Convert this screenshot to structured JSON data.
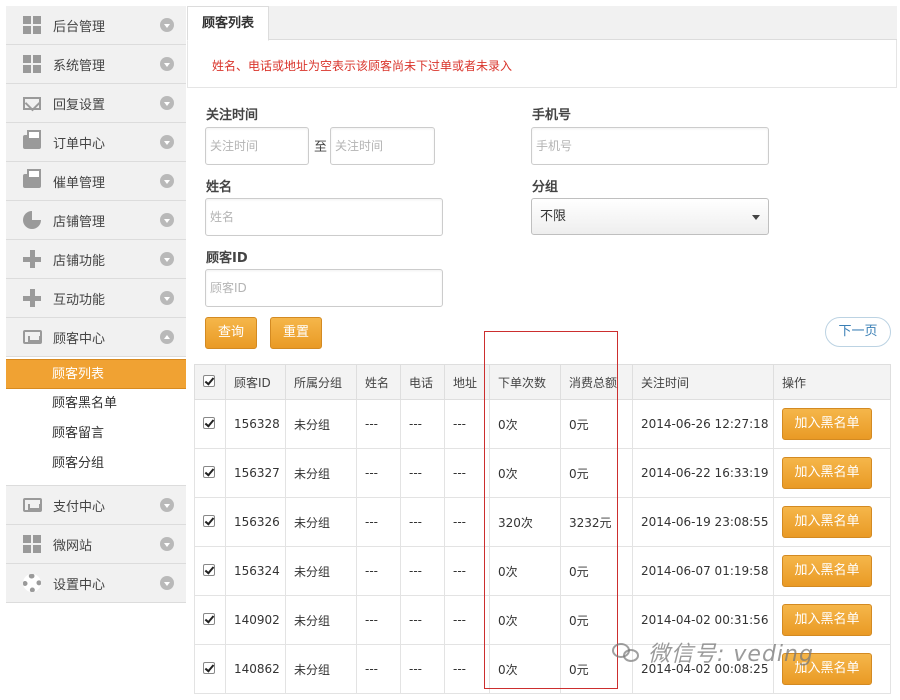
{
  "sidebar": {
    "items": [
      {
        "label": "后台管理",
        "icon": "grid-icon"
      },
      {
        "label": "系统管理",
        "icon": "grid-icon"
      },
      {
        "label": "回复设置",
        "icon": "mail-icon"
      },
      {
        "label": "订单中心",
        "icon": "printer-icon"
      },
      {
        "label": "催单管理",
        "icon": "printer-icon"
      },
      {
        "label": "店铺管理",
        "icon": "pie-chart-icon"
      },
      {
        "label": "店铺功能",
        "icon": "plus-icon"
      },
      {
        "label": "互动功能",
        "icon": "plus-icon"
      },
      {
        "label": "顾客中心",
        "icon": "inbox-icon"
      }
    ],
    "sub_items": [
      {
        "label": "顾客列表",
        "active": true
      },
      {
        "label": "顾客黑名单",
        "active": false
      },
      {
        "label": "顾客留言",
        "active": false
      },
      {
        "label": "顾客分组",
        "active": false
      }
    ],
    "bottom_items": [
      {
        "label": "支付中心",
        "icon": "inbox-icon"
      },
      {
        "label": "微网站",
        "icon": "grid-icon"
      },
      {
        "label": "设置中心",
        "icon": "gear-icon"
      }
    ]
  },
  "main": {
    "tab_label": "顾客列表",
    "notice": "姓名、电话或地址为空表示该顾客尚未下过单或者未录入",
    "filters": {
      "follow_time_label": "关注时间",
      "follow_time_start_placeholder": "关注时间",
      "to_label": "至",
      "follow_time_end_placeholder": "关注时间",
      "phone_label": "手机号",
      "phone_placeholder": "手机号",
      "name_label": "姓名",
      "name_placeholder": "姓名",
      "group_label": "分组",
      "group_value": "不限",
      "customer_id_label": "顾客ID",
      "customer_id_placeholder": "顾客ID"
    },
    "buttons": {
      "search": "查询",
      "reset": "重置",
      "next_page": "下一页"
    },
    "table": {
      "headers": [
        "顾客ID",
        "所属分组",
        "姓名",
        "电话",
        "地址",
        "下单次数",
        "消费总额",
        "关注时间",
        "操作"
      ],
      "rows": [
        {
          "id": "156328",
          "group": "未分组",
          "name": "---",
          "phone": "---",
          "address": "---",
          "orders": "0次",
          "total": "0元",
          "time": "2014-06-26 12:27:18",
          "action": "加入黑名单"
        },
        {
          "id": "156327",
          "group": "未分组",
          "name": "---",
          "phone": "---",
          "address": "---",
          "orders": "0次",
          "total": "0元",
          "time": "2014-06-22 16:33:19",
          "action": "加入黑名单"
        },
        {
          "id": "156326",
          "group": "未分组",
          "name": "---",
          "phone": "---",
          "address": "---",
          "orders": "320次",
          "total": "3232元",
          "time": "2014-06-19 23:08:55",
          "action": "加入黑名单"
        },
        {
          "id": "156324",
          "group": "未分组",
          "name": "---",
          "phone": "---",
          "address": "---",
          "orders": "0次",
          "total": "0元",
          "time": "2014-06-07 01:19:58",
          "action": "加入黑名单"
        },
        {
          "id": "140902",
          "group": "未分组",
          "name": "---",
          "phone": "---",
          "address": "---",
          "orders": "0次",
          "total": "0元",
          "time": "2014-04-02 00:31:56",
          "action": "加入黑名单"
        },
        {
          "id": "140862",
          "group": "未分组",
          "name": "---",
          "phone": "---",
          "address": "---",
          "orders": "0次",
          "total": "0元",
          "time": "2014-04-02 00:08:25",
          "action": "加入黑名单"
        }
      ]
    }
  },
  "watermark": "微信号: veding",
  "colors": {
    "accent": "#f0a233",
    "notice_text": "#d9342b",
    "highlight_border": "#cc2e2e",
    "next_link": "#3a7fb5"
  }
}
